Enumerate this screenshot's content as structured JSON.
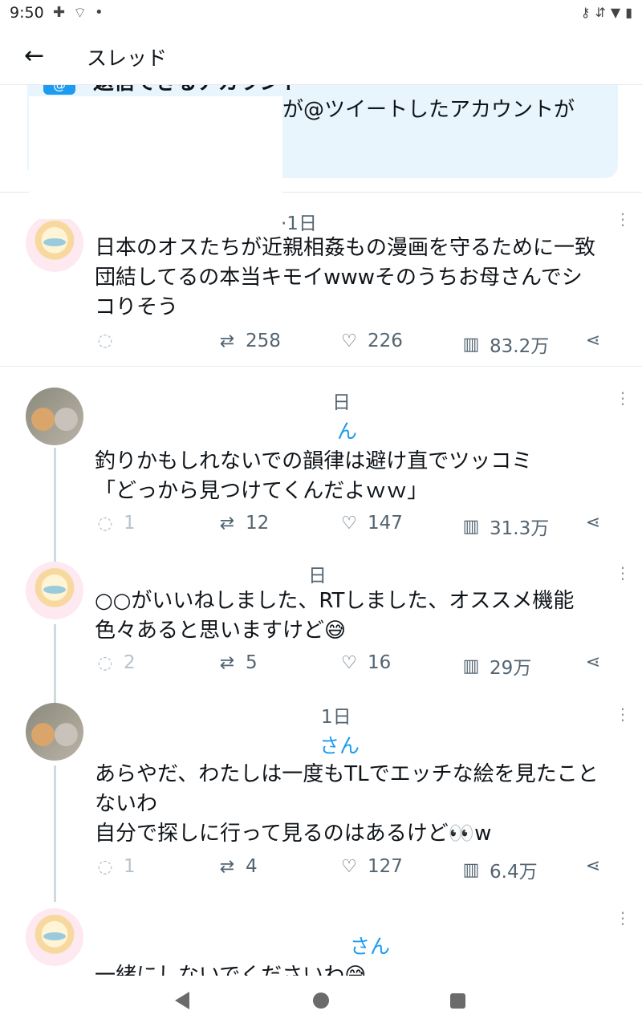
{
  "status_bar": {
    "time": "9:50",
    "left_icons": [
      "puzzle-icon",
      "wifi-icon",
      "dot-icon"
    ],
    "right_icons": [
      "key-icon",
      "signal-icon",
      "wifi-full-icon",
      "battery-icon"
    ]
  },
  "header": {
    "title": "スレッド",
    "back_icon": "arrow-left-icon"
  },
  "notice": {
    "title": "返信できるアカウント",
    "body": "が@ツイートしたアカウントが"
  },
  "tweets": [
    {
      "time": "·1日",
      "handle": "",
      "text": "日本のオスたちが近親相姦もの漫画を守るために一致\n団結してるの本当キモイwwwそのうちお母さんでシ\nコりそう",
      "replies": "",
      "retweets": "258",
      "likes": "226",
      "views": "83.2万"
    },
    {
      "time": "日",
      "handle": "ん",
      "text": "釣りかもしれないでの韻律は避け直でツッコミ\n「どっから見つけてくんだよｗｗ」",
      "replies": "1",
      "retweets": "12",
      "likes": "147",
      "views": "31.3万"
    },
    {
      "time": "日",
      "handle": "",
      "text": "○○がいいねしました、RTしました、オススメ機能\n色々あると思いますけど😅",
      "replies": "2",
      "retweets": "5",
      "likes": "16",
      "views": "29万"
    },
    {
      "time": "1日",
      "handle": "さん",
      "text": "あらやだ、わたしは一度もTLでエッチな絵を見たこと\nないわ\n自分で探しに行って見るのはあるけど👀w",
      "replies": "1",
      "retweets": "4",
      "likes": "127",
      "views": "6.4万"
    },
    {
      "time": "",
      "handle": "さん",
      "text": "一緒にしないでくださいわ😅"
    }
  ]
}
